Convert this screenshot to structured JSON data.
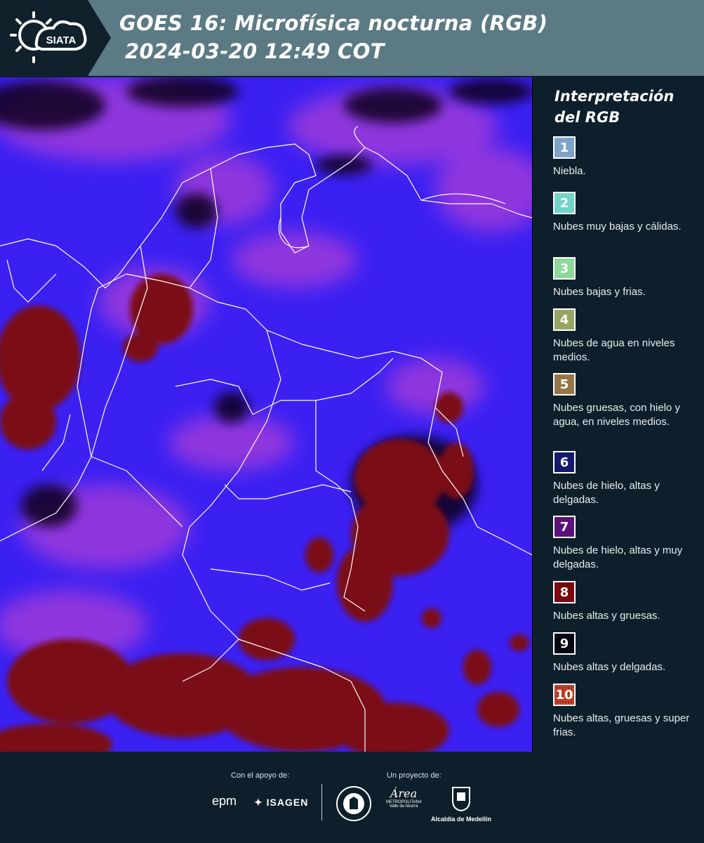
{
  "header": {
    "brand": "SIATA",
    "title_line1": "GOES 16: Microfísica nocturna (RGB)",
    "title_line2": "2024-03-20 12:49 COT",
    "background": "#5b7a84"
  },
  "legend": {
    "title": "Interpretación del RGB",
    "items": [
      {
        "num": "1",
        "label": "Niebla.",
        "color": "#7fa3c6"
      },
      {
        "num": "2",
        "label": "Nubes muy bajas y cálidas.",
        "color": "#72d3c9"
      },
      {
        "num": "3",
        "label": "Nubes bajas y frias.",
        "color": "#8fd79a"
      },
      {
        "num": "4",
        "label": "Nubes de agua en niveles medios.",
        "color": "#97a564"
      },
      {
        "num": "5",
        "label": "Nubes gruesas, con hielo y agua, en niveles medios.",
        "color": "#97774a"
      },
      {
        "num": "6",
        "label": "Nubes de hielo, altas y delgadas.",
        "color": "#14196f"
      },
      {
        "num": "7",
        "label": "Nubes de hielo, altas y muy delgadas.",
        "color": "#5b117c"
      },
      {
        "num": "8",
        "label": "Nubes altas y gruesas.",
        "color": "#7a0b0d"
      },
      {
        "num": "9",
        "label": "Nubes altas y delgadas.",
        "color": "#050611"
      },
      {
        "num": "10",
        "label": "Nubes altas, gruesas y super frias.",
        "color": "#a8321c"
      }
    ]
  },
  "map": {
    "base_color": "#3b20f2",
    "cloud_color": "#7a0e12",
    "thin_cloud_color": "#b23fd6",
    "border_color": "#ffffff"
  },
  "footer": {
    "support_label": "Con el apoyo de:",
    "project_label": "Un proyecto de:",
    "sponsor1": "epm",
    "sponsor2": "ISAGEN",
    "partner1": "Área",
    "partner1_sub": "METROPOLITANA",
    "partner1_sub2": "Valle de Aburrá",
    "partner2": "Alcaldía de Medellín"
  }
}
